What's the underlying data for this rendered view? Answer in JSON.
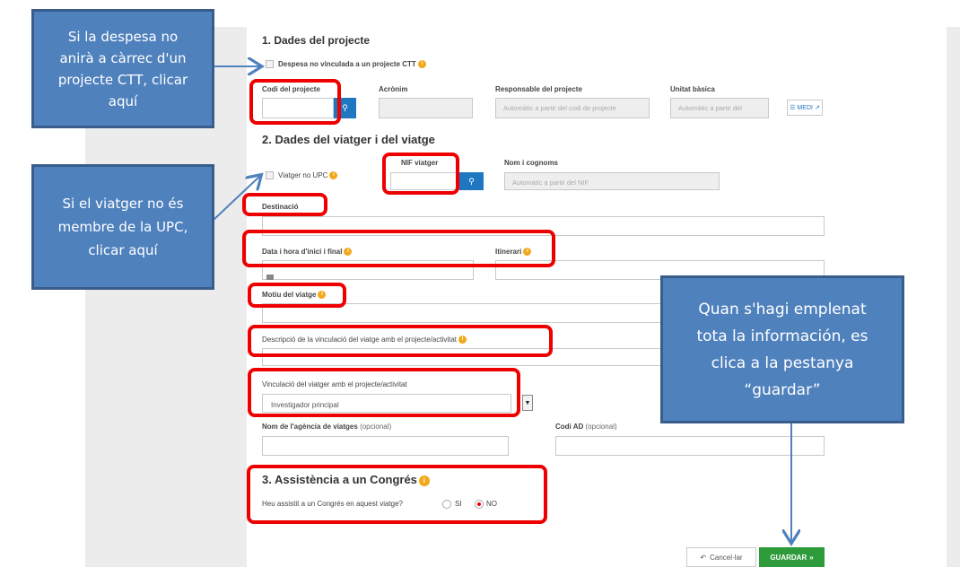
{
  "section1": {
    "title": "1. Dades del projecte",
    "checkbox_label": "Despesa no vinculada a un projecte CTT",
    "codi_label": "Codi del projecte",
    "acronim_label": "Acrònim",
    "responsable_label": "Responsable del projecte",
    "responsable_placeholder": "Automàtic a partir del codi de projecte",
    "unitat_label": "Unitat bàsica",
    "unitat_placeholder": "Automàtic a partir del",
    "medi_label": "MEDI"
  },
  "section2": {
    "title": "2. Dades del viatger i del viatge",
    "viatger_no_upc_label": "Viatger no UPC",
    "nif_label": "NIF viatger",
    "nom_label": "Nom i cognoms",
    "nom_placeholder": "Automàtic a partir del NIF",
    "destinacio_label": "Destinació",
    "data_label": "Data i hora d'inici i final",
    "itinerari_label": "Itinerari",
    "motiu_label": "Motiu del viatge",
    "descripcio_label": "Descripció de la vinculació del viatge amb el projecte/activitat",
    "vinculacio_label": "Vinculació del viatger amb el projecte/activitat",
    "vinculacio_value": "Investigador principal",
    "agencia_label": "Nom de l'agència de viatges",
    "codi_ad_label": "Codi AD",
    "optional": "(opcional)"
  },
  "section3": {
    "title": "3. Assistència a un Congrés",
    "question": "Heu assistit a un Congrés en aquest viatge?",
    "option_si": "SI",
    "option_no": "NO",
    "selected": "NO"
  },
  "buttons": {
    "cancel": "Cancel·lar",
    "save": "GUARDAR"
  },
  "callouts": {
    "c1": [
      "Si la despesa no",
      "anirà a càrrec d'un",
      "projecte CTT, clicar",
      "aquí"
    ],
    "c2": [
      "Si el viatger no és",
      "membre de la UPC,",
      "clicar aquí"
    ],
    "c3": [
      "Quan s'hagi emplenat",
      "tota la información, es",
      "clica a la pestanya",
      "“guardar”"
    ]
  },
  "colors": {
    "callout_fill": "#4f81bd",
    "callout_border": "#385d8a",
    "highlight": "#ee0000",
    "search_button": "#1f77c2",
    "save_button": "#2e9b3a",
    "info_icon": "#f2a818"
  }
}
